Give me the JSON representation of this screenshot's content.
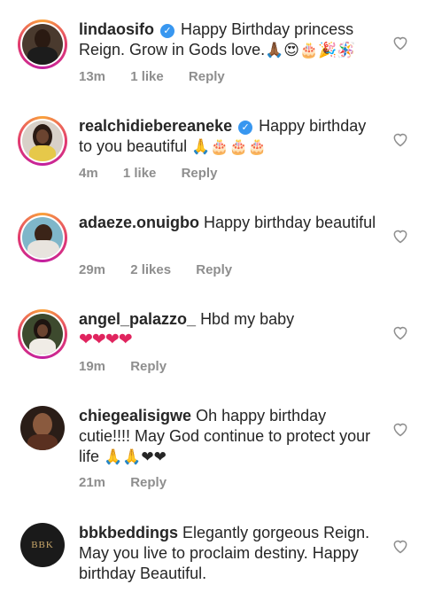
{
  "comments": [
    {
      "username": "lindaosifo",
      "verified": true,
      "text": "Happy Birthday princess Reign. Grow in Gods love.",
      "emoji": "🙏🏾😍🎂🎉🪅",
      "time": "13m",
      "likes": "1 like",
      "reply": "Reply",
      "story_ring": true
    },
    {
      "username": "realchidiebereaneke",
      "verified": true,
      "text": "Happy birthday to you beautiful",
      "emoji": "🙏🎂🎂🎂",
      "time": "4m",
      "likes": "1 like",
      "reply": "Reply",
      "story_ring": true
    },
    {
      "username": "adaeze.onuigbo",
      "verified": false,
      "text": "Happy birthday beautiful",
      "emoji": "",
      "time": "29m",
      "likes": "2 likes",
      "reply": "Reply",
      "story_ring": true
    },
    {
      "username": "angel_palazzo_",
      "verified": false,
      "text": "Hbd my baby",
      "emoji": "❤❤❤❤",
      "time": "19m",
      "likes": "",
      "reply": "Reply",
      "story_ring": true
    },
    {
      "username": "chiegealisigwe",
      "verified": false,
      "text": "Oh happy birthday cutie!!!! May God continue to protect your life",
      "emoji": "🙏🙏❤❤",
      "time": "21m",
      "likes": "",
      "reply": "Reply",
      "story_ring": false
    },
    {
      "username": "bbkbeddings",
      "verified": false,
      "text": "Elegantly gorgeous Reign. May you live to proclaim destiny. Happy birthday Beautiful.",
      "emoji": "",
      "time": "",
      "likes": "",
      "reply": "",
      "story_ring": false,
      "avatar_text": "BBK"
    }
  ],
  "colors": {
    "text": "#262626",
    "muted": "#8e8e8e",
    "verified": "#3897f0",
    "heart": "#e0245e"
  }
}
